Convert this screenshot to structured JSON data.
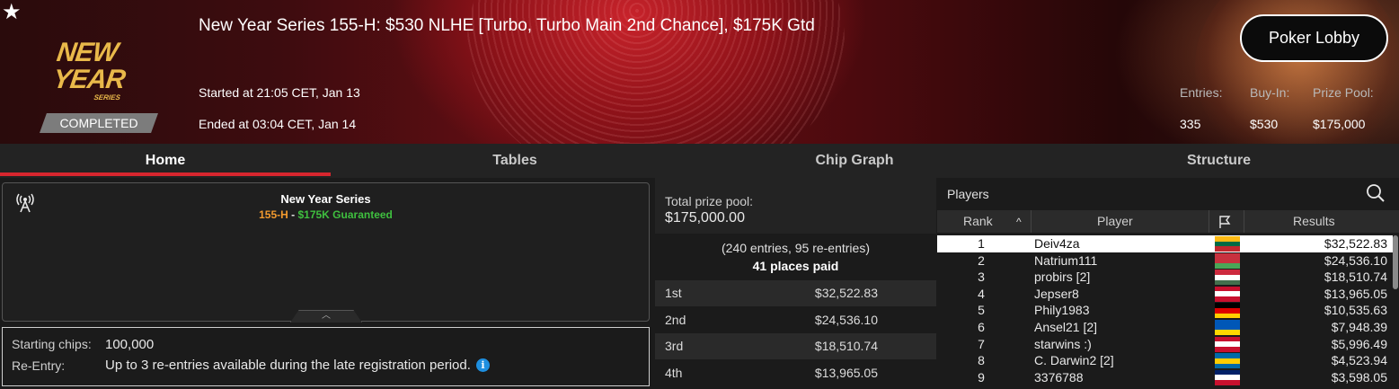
{
  "header": {
    "title": "New Year Series 155-H: $530 NLHE [Turbo, Turbo Main 2nd Chance], $175K Gtd",
    "started": "Started at 21:05 CET, Jan 13",
    "ended": "Ended at 03:04 CET, Jan 14",
    "status": "COMPLETED",
    "logo_line1": "NEW YEAR",
    "logo_line2": "SERIES",
    "lobby_button": "Poker Lobby",
    "stats": [
      {
        "label": "Entries:",
        "value": "335"
      },
      {
        "label": "Buy-In:",
        "value": "$530"
      },
      {
        "label": "Prize Pool:",
        "value": "$175,000"
      }
    ],
    "icons": {
      "favorite": "star-icon"
    }
  },
  "tabs": [
    {
      "label": "Home",
      "active": true
    },
    {
      "label": "Tables",
      "active": false
    },
    {
      "label": "Chip Graph",
      "active": false
    },
    {
      "label": "Structure",
      "active": false
    }
  ],
  "info": {
    "series_name": "New Year Series",
    "event_code": "155-H",
    "separator": " - ",
    "guarantee": "$175K Guaranteed",
    "starting_chips_label": "Starting chips:",
    "starting_chips_value": "100,000",
    "reentry_label": "Re-Entry:",
    "reentry_value": "Up to 3 re-entries available during the late registration period.",
    "info_icon_glyph": "i"
  },
  "prize": {
    "label": "Total prize pool:",
    "value": "$175,000.00",
    "entries_text": "(240 entries, 95 re-entries)",
    "places_paid": "41 places paid",
    "rows": [
      {
        "place": "1st",
        "amount": "$32,522.83"
      },
      {
        "place": "2nd",
        "amount": "$24,536.10"
      },
      {
        "place": "3rd",
        "amount": "$18,510.74"
      },
      {
        "place": "4th",
        "amount": "$13,965.05"
      }
    ]
  },
  "players": {
    "title": "Players",
    "columns": {
      "rank": "Rank",
      "player": "Player",
      "results": "Results"
    },
    "sort_glyph": "^",
    "rows": [
      {
        "rank": "1",
        "name": "Deiv4za",
        "result": "$32,522.83",
        "flag": [
          "#fdb913",
          "#006a44",
          "#c1272d"
        ]
      },
      {
        "rank": "2",
        "name": "Natrium111",
        "result": "$24,536.10",
        "flag": [
          "#c8313e",
          "#c8313e",
          "#4aa657"
        ]
      },
      {
        "rank": "3",
        "name": "probirs [2]",
        "result": "$18,510.74",
        "flag": [
          "#cd2a3e",
          "#ffffff",
          "#436f4d"
        ]
      },
      {
        "rank": "4",
        "name": "Jepser8",
        "result": "$13,965.05",
        "flag": [
          "#c8102e",
          "#ffffff",
          "#c8102e"
        ]
      },
      {
        "rank": "5",
        "name": "Phily1983",
        "result": "$10,535.63",
        "flag": [
          "#000000",
          "#dd0000",
          "#ffce00"
        ]
      },
      {
        "rank": "6",
        "name": "Ansel21 [2]",
        "result": "$7,948.39",
        "flag": [
          "#0057b7",
          "#0057b7",
          "#ffd700"
        ]
      },
      {
        "rank": "7",
        "name": "starwins :)",
        "result": "$5,996.49",
        "flag": [
          "#c8102e",
          "#ffffff",
          "#c8102e"
        ]
      },
      {
        "rank": "8",
        "name": "C. Darwin2 [2]",
        "result": "$4,523.94",
        "flag": [
          "#006aa7",
          "#fecc00",
          "#006aa7"
        ]
      },
      {
        "rank": "9",
        "name": "3376788",
        "result": "$3,598.05",
        "flag": [
          "#012169",
          "#ffffff",
          "#c8102e"
        ]
      }
    ]
  },
  "colors": {
    "accent": "#d7262e",
    "event_code": "#f29a2e",
    "guarantee": "#3fbf3f",
    "info": "#1e8fe0"
  }
}
